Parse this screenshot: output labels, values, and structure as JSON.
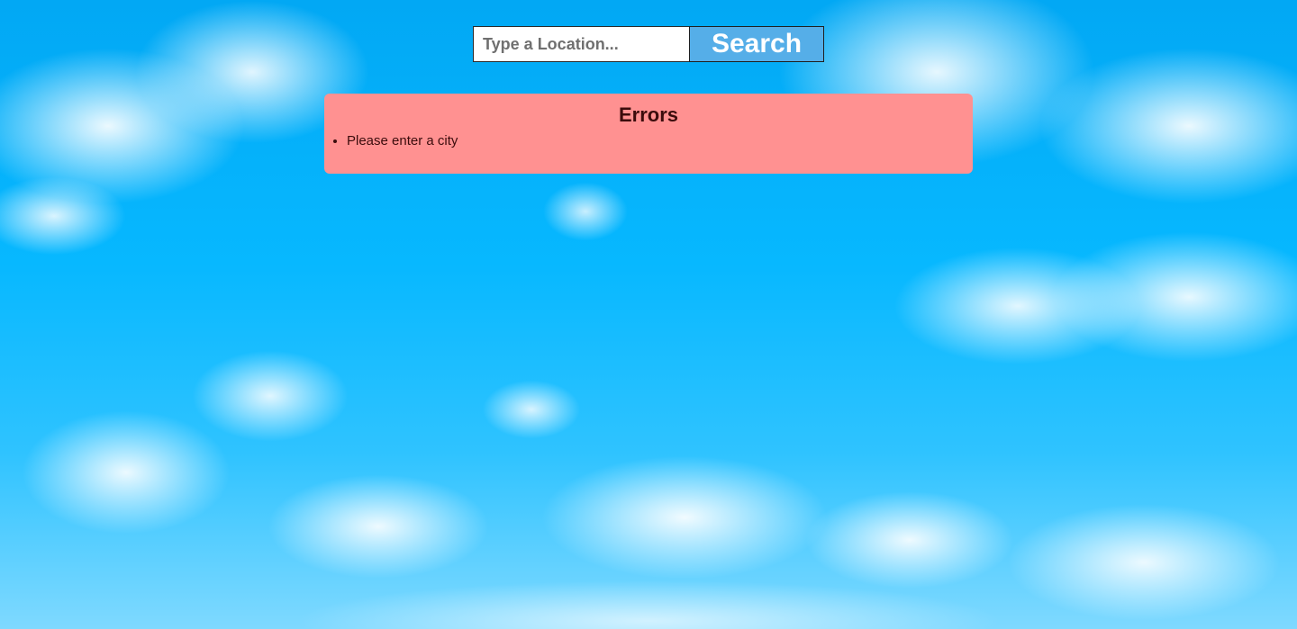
{
  "search": {
    "placeholder": "Type a Location...",
    "value": "",
    "button_label": "Search"
  },
  "errors": {
    "title": "Errors",
    "items": [
      "Please enter a city"
    ]
  }
}
